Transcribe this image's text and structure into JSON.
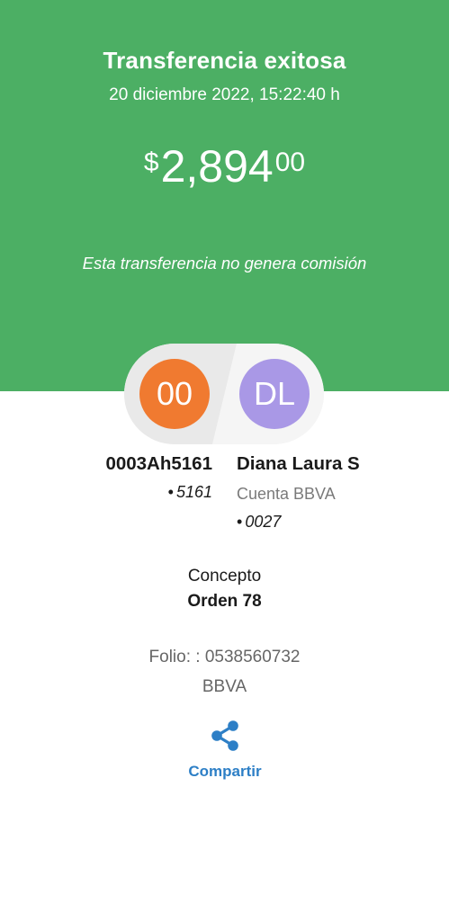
{
  "header": {
    "title": "Transferencia exitosa",
    "datetime": "20 diciembre 2022, 15:22:40 h",
    "amount": {
      "currency_symbol": "$",
      "whole": "2,894",
      "cents": "00"
    },
    "commission_note": "Esta transferencia no genera comisión"
  },
  "avatars": {
    "origin_initials": "00",
    "destination_initials": "DL"
  },
  "origin_account": {
    "name": "0003Ah5161",
    "bullet": "•",
    "number": "5161"
  },
  "destination_account": {
    "name": "Diana Laura S",
    "account_type": "Cuenta BBVA",
    "bullet": "•",
    "number": "0027"
  },
  "concept": {
    "label": "Concepto",
    "value": "Orden 78"
  },
  "folio": {
    "text": "Folio: : 0538560732",
    "bank": "BBVA"
  },
  "actions": {
    "share_label": "Compartir",
    "share_icon": "share-icon"
  },
  "colors": {
    "header_green": "#4caf64",
    "origin_avatar": "#f07a30",
    "destination_avatar": "#a998e6",
    "link_blue": "#2d7fc6"
  }
}
